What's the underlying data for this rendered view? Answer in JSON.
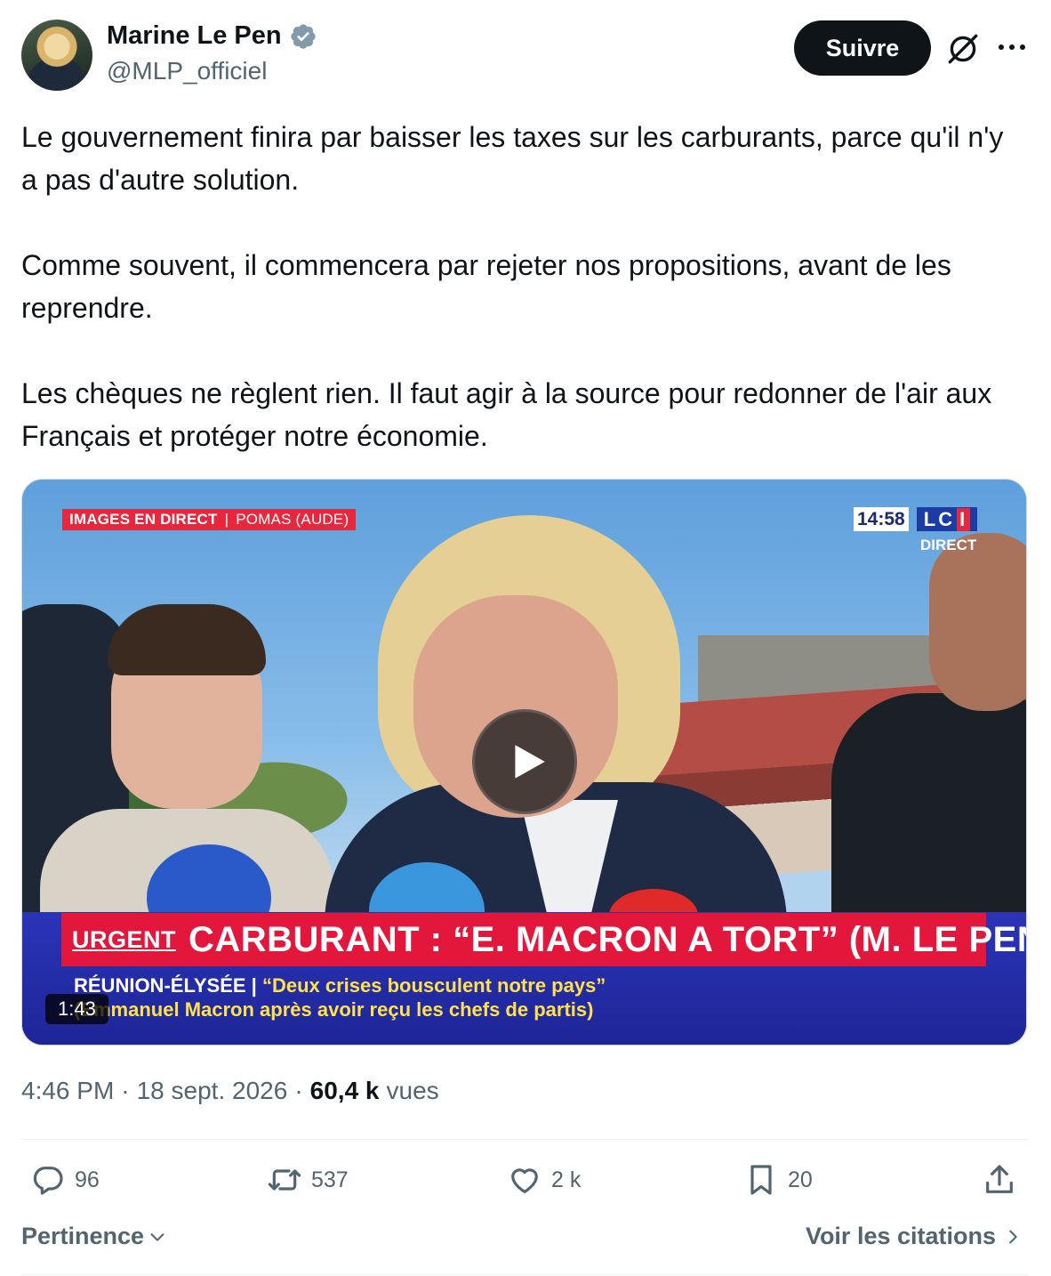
{
  "author": {
    "name": "Marine Le Pen",
    "handle": "@MLP_officiel",
    "follow_label": "Suivre"
  },
  "tweet": {
    "paragraphs": [
      "Le gouvernement finira par baisser les taxes sur les carburants, parce qu'il n'y a pas d'autre solution.",
      "Comme souvent, il commencera par rejeter nos propositions, avant de les reprendre.",
      "Les chèques ne règlent rien. Il faut agir à la source pour redonner de l'air aux Français et protéger notre économie."
    ]
  },
  "video": {
    "live_tag": "IMAGES EN DIRECT",
    "location": "POMAS (AUDE)",
    "clock": "14:58",
    "channel": "LC",
    "channel_i": "I",
    "direct": "DIRECT",
    "urgent": "URGENT",
    "headline": "CARBURANT : “E. MACRON A TORT” (M. LE PEN)",
    "sub1_label": "RÉUNION-ÉLYSÉE |",
    "sub1_quote": "“Deux crises bousculent notre pays”",
    "sub2": "(Emmanuel Macron après avoir reçu les chefs de partis)",
    "duration": "1:43"
  },
  "meta": {
    "time": "4:46 PM",
    "sep1": "·",
    "date": "18 sept. 2026",
    "sep2": "·",
    "views_count": "60,4 k",
    "views_label": "vues"
  },
  "actions": {
    "replies": "96",
    "reposts": "537",
    "likes": "2 k",
    "bookmarks": "20"
  },
  "footer": {
    "sort_label": "Pertinence",
    "quotes_label": "Voir les citations"
  },
  "colors": {
    "text_primary": "#0f1419",
    "text_secondary": "#536471",
    "verified_blue": "#829aab",
    "ticker_red": "#e3173b",
    "ticker_blue": "#1d2596"
  }
}
